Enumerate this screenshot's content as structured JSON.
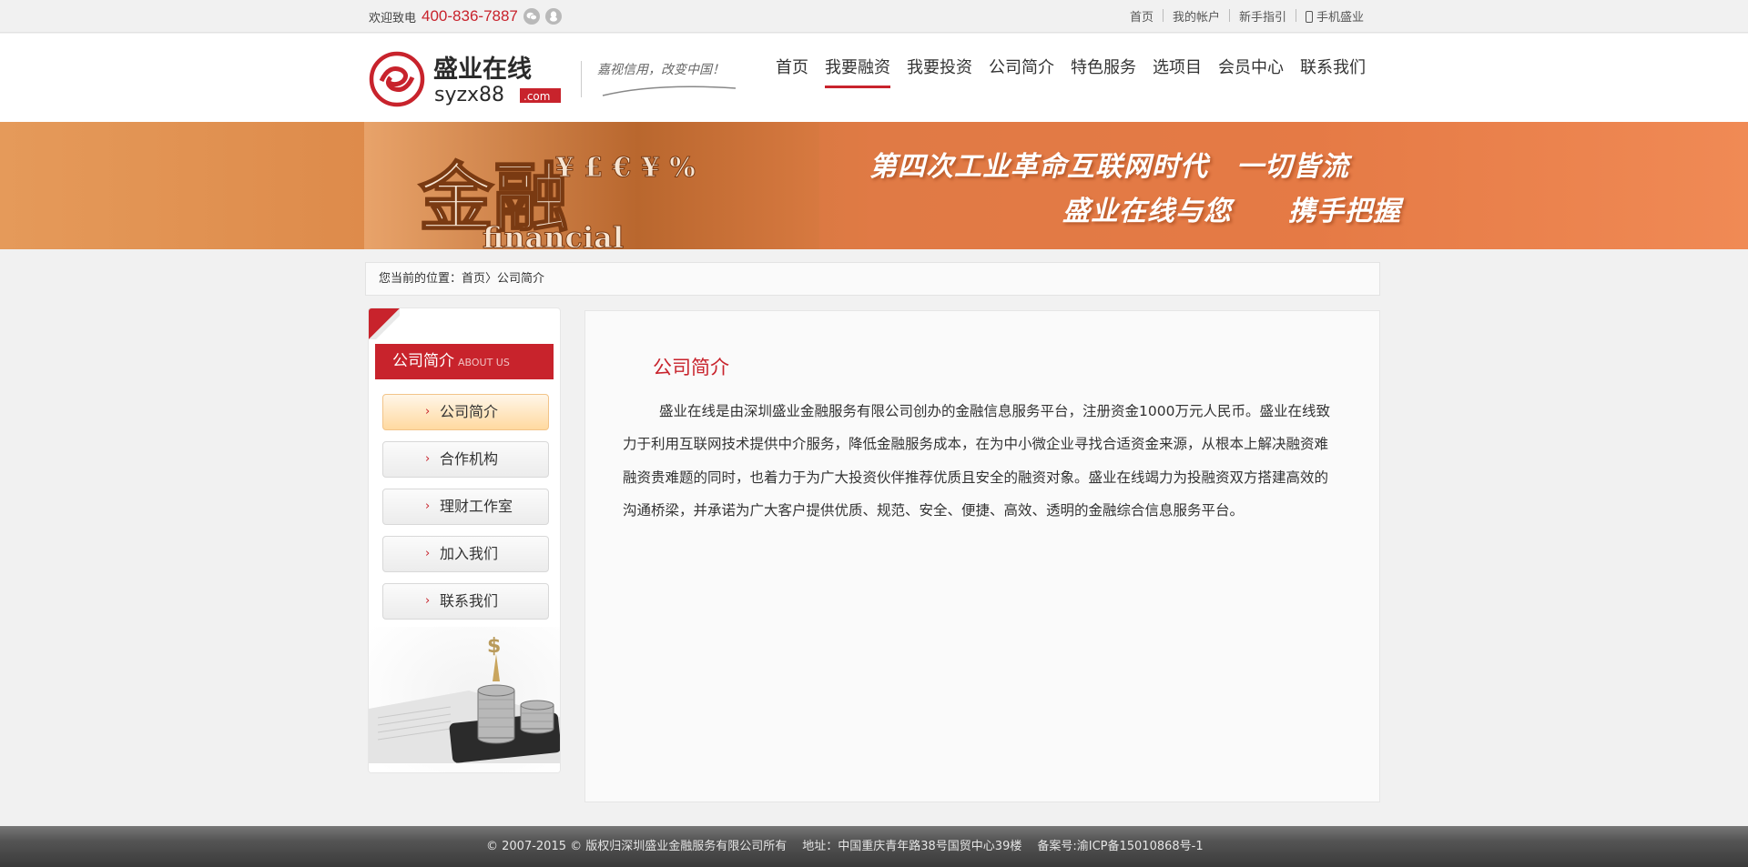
{
  "topbar": {
    "welcome": "欢迎致电",
    "phone": "400-836-7887",
    "social_icons": [
      "wechat-icon",
      "qq-icon"
    ],
    "links": [
      "首页",
      "我的帐户",
      "新手指引",
      "手机盛业"
    ]
  },
  "header": {
    "logo_cn": "盛业在线",
    "logo_en": "syzx88",
    "logo_dotcom": ".com",
    "slogan": "嘉视信用，改变中国！",
    "nav": [
      {
        "label": "首页",
        "active": false
      },
      {
        "label": "我要融资",
        "active": true
      },
      {
        "label": "我要投资",
        "active": false
      },
      {
        "label": "公司简介",
        "active": false
      },
      {
        "label": "特色服务",
        "active": false
      },
      {
        "label": "选项目",
        "active": false
      },
      {
        "label": "会员中心",
        "active": false
      },
      {
        "label": "联系我们",
        "active": false
      }
    ]
  },
  "banner": {
    "line1": "第四次工业革命互联网时代　一切皆流",
    "line2": "盛业在线与您　　携手把握",
    "art_text_big": "金融",
    "art_symbols": "¥ £ € ¥ %",
    "art_word": "financial"
  },
  "breadcrumb": {
    "label": "您当前的位置：",
    "home": "首页",
    "separator": "〉",
    "current": "公司简介"
  },
  "sidebar": {
    "title": "公司简介",
    "title_en": "ABOUT US",
    "items": [
      {
        "label": "公司简介",
        "active": true
      },
      {
        "label": "合作机构",
        "active": false
      },
      {
        "label": "理财工作室",
        "active": false
      },
      {
        "label": "加入我们",
        "active": false
      },
      {
        "label": "联系我们",
        "active": false
      }
    ]
  },
  "content": {
    "title": "公司简介",
    "body": "盛业在线是由深圳盛业金融服务有限公司创办的金融信息服务平台，注册资金1000万元人民币。盛业在线致力于利用互联网技术提供中介服务，降低金融服务成本，在为中小微企业寻找合适资金来源，从根本上解决融资难融资贵难题的同时，也着力于为广大投资伙伴推荐优质且安全的融资对象。盛业在线竭力为投融资双方搭建高效的沟通桥梁，并承诺为广大客户提供优质、规范、安全、便捷、高效、透明的金融综合信息服务平台。"
  },
  "footer": {
    "copyright": "© 2007-2015 © 版权归深圳盛业金融服务有限公司所有",
    "address": "地址：中国重庆青年路38号国贸中心39楼",
    "icp": "备案号:渝ICP备15010868号-1"
  },
  "colors": {
    "brand_red": "#c8232c",
    "banner_orange": "#e07a45",
    "footer_dark": "#4a4a4a"
  }
}
